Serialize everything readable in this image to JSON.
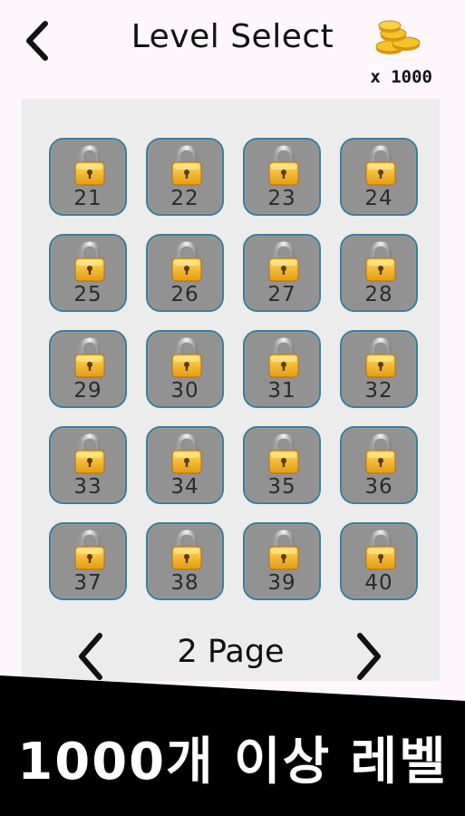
{
  "header": {
    "title": "Level Select",
    "coins_label": "x 1000",
    "back_icon": "chevron-left-icon",
    "coin_icon": "coin-stack-icon"
  },
  "levels": [
    {
      "number": "21",
      "locked": true
    },
    {
      "number": "22",
      "locked": true
    },
    {
      "number": "23",
      "locked": true
    },
    {
      "number": "24",
      "locked": true
    },
    {
      "number": "25",
      "locked": true
    },
    {
      "number": "26",
      "locked": true
    },
    {
      "number": "27",
      "locked": true
    },
    {
      "number": "28",
      "locked": true
    },
    {
      "number": "29",
      "locked": true
    },
    {
      "number": "30",
      "locked": true
    },
    {
      "number": "31",
      "locked": true
    },
    {
      "number": "32",
      "locked": true
    },
    {
      "number": "33",
      "locked": true
    },
    {
      "number": "34",
      "locked": true
    },
    {
      "number": "35",
      "locked": true
    },
    {
      "number": "36",
      "locked": true
    },
    {
      "number": "37",
      "locked": true
    },
    {
      "number": "38",
      "locked": true
    },
    {
      "number": "39",
      "locked": true
    },
    {
      "number": "40",
      "locked": true
    }
  ],
  "pager": {
    "label": "2 Page",
    "prev_icon": "chevron-left-icon",
    "next_icon": "chevron-right-icon"
  },
  "banner": {
    "text": "1000개 이상 레벨"
  },
  "colors": {
    "tile_bg": "#929292",
    "tile_border": "#3e7d99",
    "panel_bg": "#ececec",
    "lock_gold": "#f2b422"
  }
}
